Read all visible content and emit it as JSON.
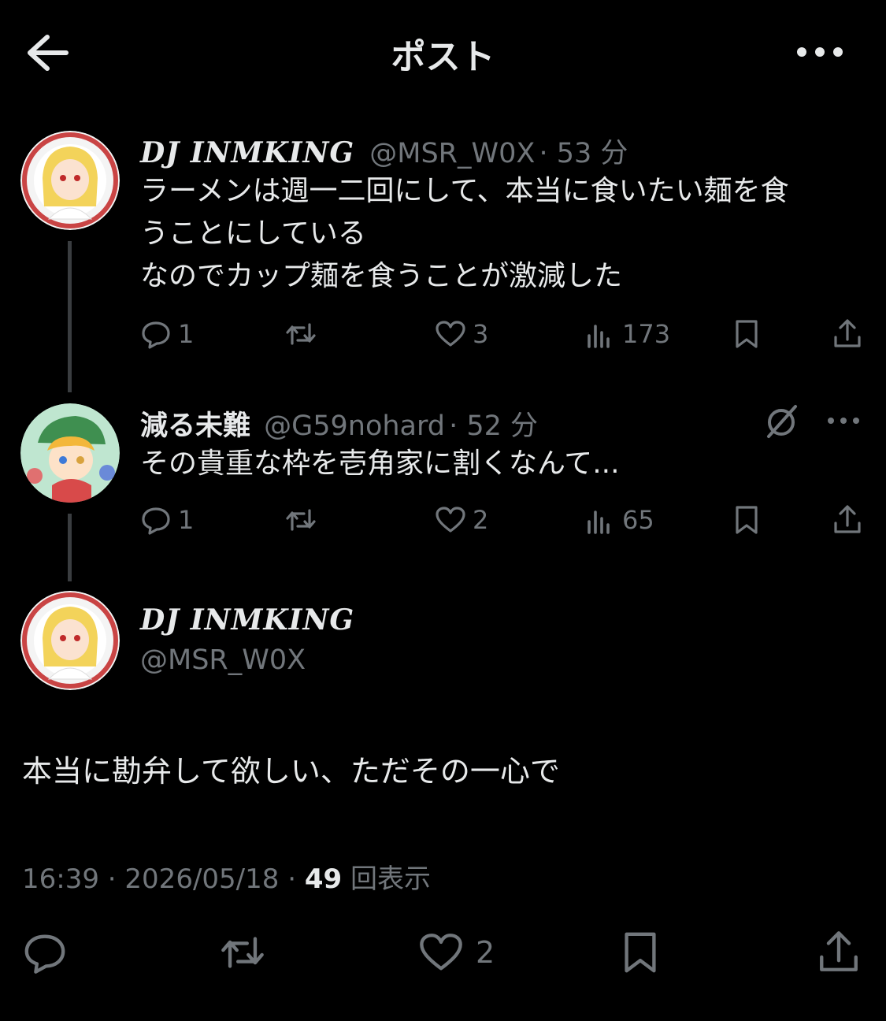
{
  "header": {
    "title": "ポスト",
    "back_icon": "arrow-left-icon",
    "more_icon": "more-icon"
  },
  "tweets": [
    {
      "name": "DJ INMKING",
      "handle": "@MSR_W0X",
      "time": "· 53 分",
      "text": [
        "ラーメンは週一二回にして、本当に食いたい麺を食",
        "うことにしている",
        "なのでカップ麺を食うことが激減した"
      ],
      "replies": "1",
      "likes": "3",
      "views": "173"
    },
    {
      "name": "減る未難",
      "handle": "@G59nohard",
      "time": "· 52 分",
      "text": [
        "その貴重な枠を壱角家に割くなんて..."
      ],
      "replies": "1",
      "likes": "2",
      "views": "65"
    }
  ],
  "detail": {
    "name": "DJ INMKING",
    "handle": "@MSR_W0X",
    "text": "本当に勘弁して欲しい、ただその一心で",
    "time": "16:39",
    "date": "2026/05/18",
    "views": "49",
    "views_label": "回表示",
    "likes": "2"
  },
  "colors": {
    "bg": "#000000",
    "text": "#e7e9ea",
    "muted": "#71767b",
    "line": "#3a3d40"
  }
}
